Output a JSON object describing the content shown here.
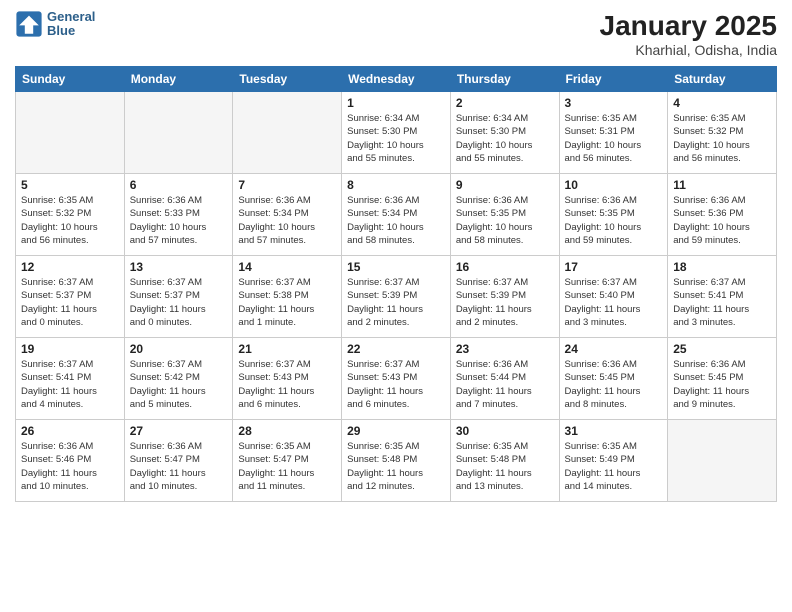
{
  "header": {
    "logo_line1": "General",
    "logo_line2": "Blue",
    "month": "January 2025",
    "location": "Kharhial, Odisha, India"
  },
  "weekdays": [
    "Sunday",
    "Monday",
    "Tuesday",
    "Wednesday",
    "Thursday",
    "Friday",
    "Saturday"
  ],
  "weeks": [
    [
      {
        "day": "",
        "info": ""
      },
      {
        "day": "",
        "info": ""
      },
      {
        "day": "",
        "info": ""
      },
      {
        "day": "1",
        "info": "Sunrise: 6:34 AM\nSunset: 5:30 PM\nDaylight: 10 hours\nand 55 minutes."
      },
      {
        "day": "2",
        "info": "Sunrise: 6:34 AM\nSunset: 5:30 PM\nDaylight: 10 hours\nand 55 minutes."
      },
      {
        "day": "3",
        "info": "Sunrise: 6:35 AM\nSunset: 5:31 PM\nDaylight: 10 hours\nand 56 minutes."
      },
      {
        "day": "4",
        "info": "Sunrise: 6:35 AM\nSunset: 5:32 PM\nDaylight: 10 hours\nand 56 minutes."
      }
    ],
    [
      {
        "day": "5",
        "info": "Sunrise: 6:35 AM\nSunset: 5:32 PM\nDaylight: 10 hours\nand 56 minutes."
      },
      {
        "day": "6",
        "info": "Sunrise: 6:36 AM\nSunset: 5:33 PM\nDaylight: 10 hours\nand 57 minutes."
      },
      {
        "day": "7",
        "info": "Sunrise: 6:36 AM\nSunset: 5:34 PM\nDaylight: 10 hours\nand 57 minutes."
      },
      {
        "day": "8",
        "info": "Sunrise: 6:36 AM\nSunset: 5:34 PM\nDaylight: 10 hours\nand 58 minutes."
      },
      {
        "day": "9",
        "info": "Sunrise: 6:36 AM\nSunset: 5:35 PM\nDaylight: 10 hours\nand 58 minutes."
      },
      {
        "day": "10",
        "info": "Sunrise: 6:36 AM\nSunset: 5:35 PM\nDaylight: 10 hours\nand 59 minutes."
      },
      {
        "day": "11",
        "info": "Sunrise: 6:36 AM\nSunset: 5:36 PM\nDaylight: 10 hours\nand 59 minutes."
      }
    ],
    [
      {
        "day": "12",
        "info": "Sunrise: 6:37 AM\nSunset: 5:37 PM\nDaylight: 11 hours\nand 0 minutes."
      },
      {
        "day": "13",
        "info": "Sunrise: 6:37 AM\nSunset: 5:37 PM\nDaylight: 11 hours\nand 0 minutes."
      },
      {
        "day": "14",
        "info": "Sunrise: 6:37 AM\nSunset: 5:38 PM\nDaylight: 11 hours\nand 1 minute."
      },
      {
        "day": "15",
        "info": "Sunrise: 6:37 AM\nSunset: 5:39 PM\nDaylight: 11 hours\nand 2 minutes."
      },
      {
        "day": "16",
        "info": "Sunrise: 6:37 AM\nSunset: 5:39 PM\nDaylight: 11 hours\nand 2 minutes."
      },
      {
        "day": "17",
        "info": "Sunrise: 6:37 AM\nSunset: 5:40 PM\nDaylight: 11 hours\nand 3 minutes."
      },
      {
        "day": "18",
        "info": "Sunrise: 6:37 AM\nSunset: 5:41 PM\nDaylight: 11 hours\nand 3 minutes."
      }
    ],
    [
      {
        "day": "19",
        "info": "Sunrise: 6:37 AM\nSunset: 5:41 PM\nDaylight: 11 hours\nand 4 minutes."
      },
      {
        "day": "20",
        "info": "Sunrise: 6:37 AM\nSunset: 5:42 PM\nDaylight: 11 hours\nand 5 minutes."
      },
      {
        "day": "21",
        "info": "Sunrise: 6:37 AM\nSunset: 5:43 PM\nDaylight: 11 hours\nand 6 minutes."
      },
      {
        "day": "22",
        "info": "Sunrise: 6:37 AM\nSunset: 5:43 PM\nDaylight: 11 hours\nand 6 minutes."
      },
      {
        "day": "23",
        "info": "Sunrise: 6:36 AM\nSunset: 5:44 PM\nDaylight: 11 hours\nand 7 minutes."
      },
      {
        "day": "24",
        "info": "Sunrise: 6:36 AM\nSunset: 5:45 PM\nDaylight: 11 hours\nand 8 minutes."
      },
      {
        "day": "25",
        "info": "Sunrise: 6:36 AM\nSunset: 5:45 PM\nDaylight: 11 hours\nand 9 minutes."
      }
    ],
    [
      {
        "day": "26",
        "info": "Sunrise: 6:36 AM\nSunset: 5:46 PM\nDaylight: 11 hours\nand 10 minutes."
      },
      {
        "day": "27",
        "info": "Sunrise: 6:36 AM\nSunset: 5:47 PM\nDaylight: 11 hours\nand 10 minutes."
      },
      {
        "day": "28",
        "info": "Sunrise: 6:35 AM\nSunset: 5:47 PM\nDaylight: 11 hours\nand 11 minutes."
      },
      {
        "day": "29",
        "info": "Sunrise: 6:35 AM\nSunset: 5:48 PM\nDaylight: 11 hours\nand 12 minutes."
      },
      {
        "day": "30",
        "info": "Sunrise: 6:35 AM\nSunset: 5:48 PM\nDaylight: 11 hours\nand 13 minutes."
      },
      {
        "day": "31",
        "info": "Sunrise: 6:35 AM\nSunset: 5:49 PM\nDaylight: 11 hours\nand 14 minutes."
      },
      {
        "day": "",
        "info": ""
      }
    ]
  ]
}
